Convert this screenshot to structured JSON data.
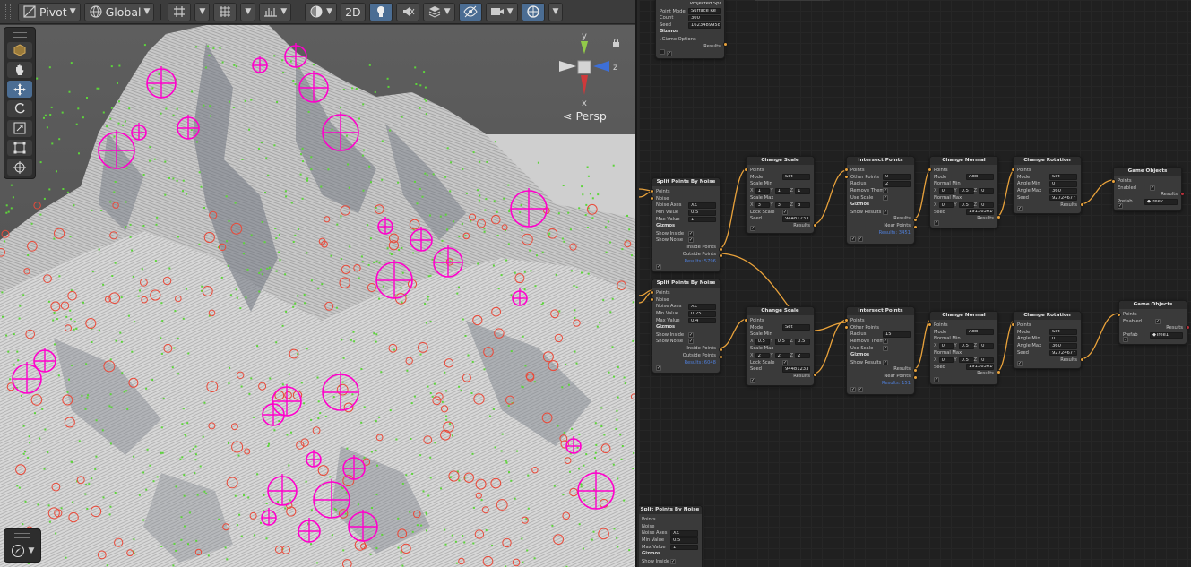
{
  "toolbar": {
    "pivot_label": "Pivot",
    "global_label": "Global",
    "mode_2d_label": "2D"
  },
  "scene": {
    "persp_label": "Persp",
    "gizmo_axes": {
      "y": "y",
      "x": "x",
      "z": "z"
    },
    "tools": [
      "view-tool-icon",
      "hand-icon",
      "move-icon",
      "rotate-icon",
      "scale-icon",
      "rect-icon",
      "transform-icon"
    ],
    "colors": {
      "accent": "#4b6d93",
      "axis_x": "#d0393b",
      "axis_y": "#92c94a",
      "axis_z": "#3d6fd7",
      "marker_large": "#ff00cc",
      "marker_small": "#e94a3a",
      "point_green": "#5dd43b"
    }
  },
  "graph": {
    "node_top": {
      "projected_label": "Projected Sphere",
      "rows": [
        {
          "label": "Point Mode",
          "value": "Surface Re"
        },
        {
          "label": "Count",
          "value": "300"
        },
        {
          "label": "Seed",
          "value": "1623489958"
        }
      ],
      "gizmos_label": "Gizmos",
      "gizmo_options_label": "Gizmo Options",
      "results_label": "Results"
    },
    "split_a": {
      "title": "Split Points By Noise",
      "points_label": "Points",
      "noise_label": "Noise",
      "rows": [
        {
          "label": "Noise Axes",
          "value": "XZ"
        },
        {
          "label": "Min Value",
          "value": "0.5"
        },
        {
          "label": "Max Value",
          "value": "1"
        }
      ],
      "gizmos_label": "Gizmos",
      "show_inside_label": "Show Inside",
      "show_noise_label": "Show Noise",
      "inside_points_label": "Inside Points",
      "outside_points_label": "Outside Points",
      "results_label": "Results: 5796"
    },
    "split_b": {
      "title": "Split Points By Noise",
      "points_label": "Points",
      "noise_label": "Noise",
      "rows": [
        {
          "label": "Noise Axes",
          "value": "XZ"
        },
        {
          "label": "Min Value",
          "value": "0.25"
        },
        {
          "label": "Max Value",
          "value": "0.4"
        }
      ],
      "gizmos_label": "Gizmos",
      "show_inside_label": "Show Inside",
      "show_noise_label": "Show Noise",
      "inside_points_label": "Inside Points",
      "outside_points_label": "Outside Points",
      "results_label": "Results: 6048"
    },
    "split_c": {
      "title": "Split Points By Noise",
      "points_label": "Points",
      "noise_label": "Noise",
      "rows": [
        {
          "label": "Noise Axes",
          "value": "XZ"
        },
        {
          "label": "Min Value",
          "value": "0.5"
        },
        {
          "label": "Max Value",
          "value": "1"
        }
      ],
      "gizmos_label": "Gizmos",
      "show_inside_label": "Show Inside"
    },
    "scale_a": {
      "title": "Change Scale",
      "points_label": "Points",
      "mode_label": "Mode",
      "mode_value": "Set",
      "scale_min_label": "Scale Min",
      "scale_min": [
        "1",
        "1",
        "1"
      ],
      "scale_max_label": "Scale Max",
      "scale_max": [
        "3",
        "3",
        "3"
      ],
      "lock_scale_label": "Lock Scale",
      "seed_label": "Seed",
      "seed_value": "944812337",
      "results_label": "Results"
    },
    "scale_b": {
      "title": "Change Scale",
      "points_label": "Points",
      "mode_label": "Mode",
      "mode_value": "Set",
      "scale_min_label": "Scale Min",
      "scale_min": [
        "0.5",
        "0.5",
        "0.5"
      ],
      "scale_max_label": "Scale Max",
      "scale_max": [
        "2",
        "2",
        "2"
      ],
      "lock_scale_label": "Lock Scale",
      "seed_label": "Seed",
      "seed_value": "944812337",
      "results_label": "Results"
    },
    "intersect_a": {
      "title": "Intersect Points",
      "points_label": "Points",
      "other_points_label": "Other Points",
      "other_points_value": "0",
      "radius_label": "Radius",
      "radius_value": "2",
      "remove_them_label": "Remove Them",
      "use_scale_label": "Use Scale",
      "gizmos_label": "Gizmos",
      "show_results_label": "Show Results",
      "results_label": "Results",
      "near_points_label": "Near Points",
      "results_count": "Results: 3451"
    },
    "intersect_b": {
      "title": "Intersect Points",
      "points_label": "Points",
      "other_points_label": "Other Points",
      "radius_label": "Radius",
      "radius_value": "15",
      "remove_them_label": "Remove Them",
      "use_scale_label": "Use Scale",
      "gizmos_label": "Gizmos",
      "show_results_label": "Show Results",
      "results_label": "Results",
      "near_points_label": "Near Points",
      "results_count": "Results: 151"
    },
    "normal_a": {
      "title": "Change Normal",
      "points_label": "Points",
      "mode_label": "Mode",
      "mode_value": "Add",
      "normal_min_label": "Normal Min",
      "normal_min": [
        "0",
        "0.5",
        "0"
      ],
      "normal_max_label": "Normal Max",
      "normal_max": [
        "0",
        "0.5",
        "0"
      ],
      "seed_label": "Seed",
      "seed_value": "1915636161",
      "results_label": "Results"
    },
    "normal_b": {
      "title": "Change Normal",
      "points_label": "Points",
      "mode_label": "Mode",
      "mode_value": "Add",
      "normal_min_label": "Normal Min",
      "normal_min": [
        "0",
        "0.5",
        "0"
      ],
      "normal_max_label": "Normal Max",
      "normal_max": [
        "0",
        "0.5",
        "0"
      ],
      "seed_label": "Seed",
      "seed_value": "1915636161",
      "results_label": "Results"
    },
    "rotation_a": {
      "title": "Change Rotation",
      "points_label": "Points",
      "mode_label": "Mode",
      "mode_value": "Set",
      "angle_min_label": "Angle Min",
      "angle_min_value": "0",
      "angle_max_label": "Angle Max",
      "angle_max_value": "360",
      "seed_label": "Seed",
      "seed_value": "9272467?",
      "results_label": "Results"
    },
    "rotation_b": {
      "title": "Change Rotation",
      "points_label": "Points",
      "mode_label": "Mode",
      "mode_value": "Set",
      "angle_min_label": "Angle Min",
      "angle_min_value": "0",
      "angle_max_label": "Angle Max",
      "angle_max_value": "360",
      "seed_label": "Seed",
      "seed_value": "9272467?",
      "results_label": "Results"
    },
    "objects_a": {
      "title": "Game Objects",
      "points_label": "Points",
      "enabled_label": "Enabled",
      "results_label": "Results",
      "prefab_label": "Prefab",
      "prefab_value": "Tree2"
    },
    "objects_b": {
      "title": "Game Objects",
      "points_label": "Points",
      "enabled_label": "Enabled",
      "results_label": "Results",
      "prefab_label": "Prefab",
      "prefab_value": "Tree1"
    }
  }
}
